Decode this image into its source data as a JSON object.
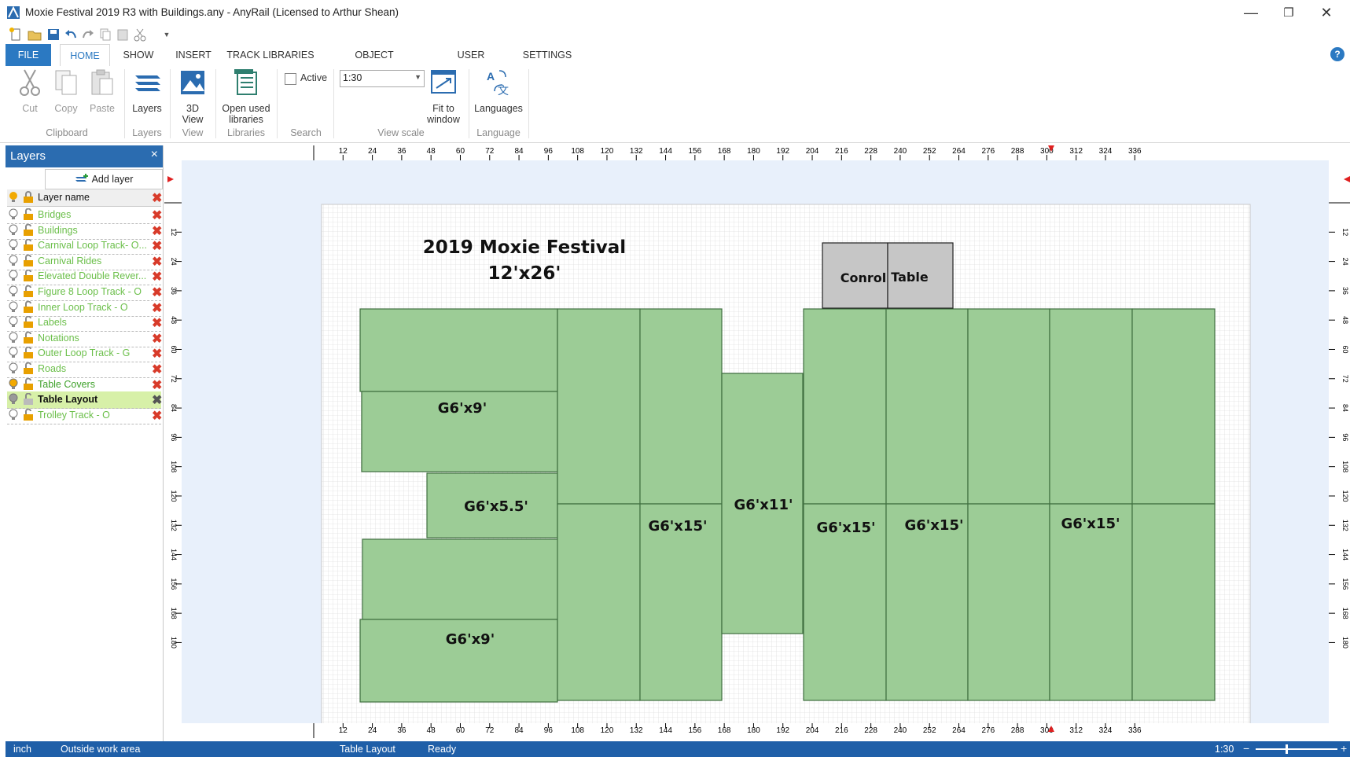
{
  "window": {
    "title": "Moxie Festival 2019 R3 with Buildings.any - AnyRail (Licensed to Arthur Shean)",
    "controls": [
      "—",
      "❐",
      "✕"
    ]
  },
  "ribbon": {
    "tabs": [
      "FILE",
      "HOME",
      "SHOW",
      "INSERT",
      "TRACK LIBRARIES",
      "OBJECT LIBRARIES",
      "USER OBJECTS",
      "SETTINGS"
    ],
    "active_tab": "HOME",
    "help_label": "?",
    "clipboard": {
      "cut": "Cut",
      "copy": "Copy",
      "paste": "Paste",
      "group": "Clipboard"
    },
    "layers": {
      "button": "Layers",
      "group": "Layers"
    },
    "view": {
      "button": "3D View",
      "group": "View"
    },
    "libraries": {
      "button": "Open used libraries",
      "group": "Libraries"
    },
    "search": {
      "checkbox_label": "Active",
      "group": "Search"
    },
    "view_scale": {
      "value": "1:30",
      "fit_button": "Fit to window",
      "group": "View scale"
    },
    "language": {
      "button": "Languages",
      "group": "Language"
    }
  },
  "layers_panel": {
    "title": "Layers",
    "close": "×",
    "add_button": "Add layer",
    "header": "Layer name",
    "items": [
      {
        "name": "Bridges",
        "state": "normal"
      },
      {
        "name": "Buildings",
        "state": "normal"
      },
      {
        "name": "Carnival Loop Track- O...",
        "state": "normal"
      },
      {
        "name": "Carnival Rides",
        "state": "normal"
      },
      {
        "name": "Elevated Double Rever...",
        "state": "normal"
      },
      {
        "name": "Figure 8 Loop Track - O",
        "state": "normal"
      },
      {
        "name": "Inner Loop Track - O",
        "state": "normal"
      },
      {
        "name": "Labels",
        "state": "normal"
      },
      {
        "name": "Notations",
        "state": "normal"
      },
      {
        "name": "Outer Loop Track - G",
        "state": "normal"
      },
      {
        "name": "Roads",
        "state": "normal"
      },
      {
        "name": "Table Covers",
        "state": "active"
      },
      {
        "name": "Table Layout",
        "state": "selected"
      },
      {
        "name": "Trolley Track - O",
        "state": "normal"
      }
    ]
  },
  "rulers": {
    "top_ticks": [
      "12",
      "24",
      "36",
      "48",
      "60",
      "72",
      "84",
      "96",
      "108",
      "120",
      "132",
      "144",
      "156",
      "168",
      "180",
      "192",
      "204",
      "216",
      "228",
      "240",
      "252",
      "264",
      "276",
      "288",
      "300",
      "312",
      "324",
      "336"
    ],
    "side_ticks": [
      "12",
      "24",
      "36",
      "48",
      "60",
      "72",
      "84",
      "96",
      "108",
      "120",
      "132",
      "144",
      "156",
      "168",
      "180"
    ]
  },
  "layout": {
    "title_line1": "2019  Moxie  Festival",
    "title_line2": "12'x26'",
    "labels": {
      "g6x9_top": "G6'x9'",
      "g6x55": "G6'x5.5'",
      "g6x9_bottom": "G6'x9'",
      "g6x15_a": "G6'x15'",
      "g6x11": "G6'x11'",
      "g6x15_b": "G6'x15'",
      "g6x15_c": "G6'x15'",
      "g6x15_d": "G6'x15'",
      "control": "Conrol",
      "table": "Table"
    },
    "colors": {
      "table_fill": "#9ccc96",
      "table_stroke": "#3f6f3f",
      "control_fill": "#c6c6c6",
      "board_bg": "#e8f0fb"
    }
  },
  "status": {
    "unit": "inch",
    "area": "Outside work area",
    "layer": "Table Layout",
    "state": "Ready",
    "scale": "1:30",
    "zoom_minus": "−",
    "zoom_plus": "+"
  }
}
